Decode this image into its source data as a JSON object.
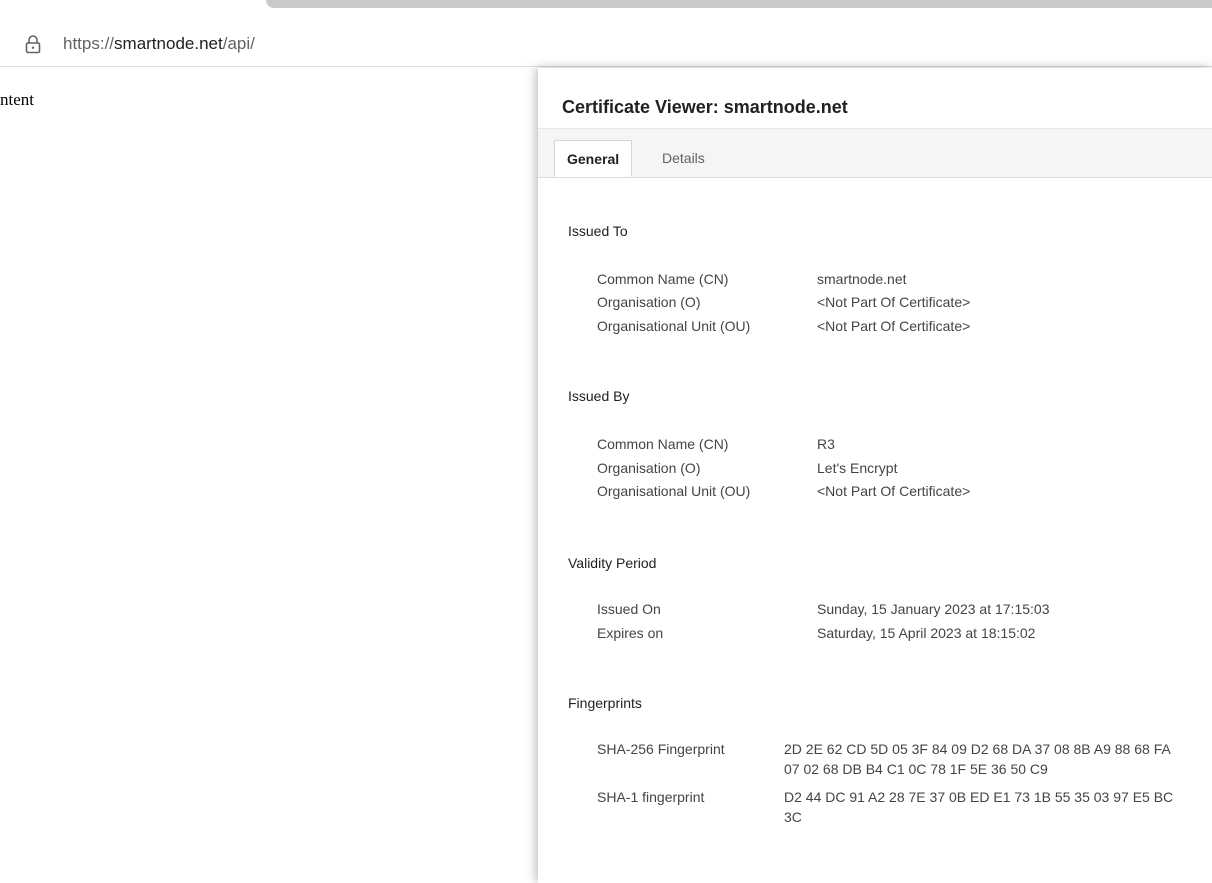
{
  "browser": {
    "url_scheme": "https://",
    "url_host": "smartnode.net",
    "url_path": "/api/"
  },
  "page": {
    "text_fragment": "ntent"
  },
  "dialog": {
    "title": "Certificate Viewer: smartnode.net",
    "tabs": [
      {
        "label": "General",
        "active": true
      },
      {
        "label": "Details",
        "active": false
      }
    ],
    "issued_to": {
      "heading": "Issued To",
      "rows": [
        {
          "label": "Common Name (CN)",
          "value": "smartnode.net"
        },
        {
          "label": "Organisation (O)",
          "value": "<Not Part Of Certificate>"
        },
        {
          "label": "Organisational Unit (OU)",
          "value": "<Not Part Of Certificate>"
        }
      ]
    },
    "issued_by": {
      "heading": "Issued By",
      "rows": [
        {
          "label": "Common Name (CN)",
          "value": "R3"
        },
        {
          "label": "Organisation (O)",
          "value": "Let's Encrypt"
        },
        {
          "label": "Organisational Unit (OU)",
          "value": "<Not Part Of Certificate>"
        }
      ]
    },
    "validity": {
      "heading": "Validity Period",
      "rows": [
        {
          "label": "Issued On",
          "value": "Sunday, 15 January 2023 at 17:15:03"
        },
        {
          "label": "Expires on",
          "value": "Saturday, 15 April 2023 at 18:15:02"
        }
      ]
    },
    "fingerprints": {
      "heading": "Fingerprints",
      "rows": [
        {
          "label": "SHA-256 Fingerprint",
          "value": "2D 2E 62 CD 5D 05 3F 84 09 D2 68 DA 37 08 8B A9 88 68 FA 07 02 68 DB B4 C1 0C 78 1F 5E 36 50 C9"
        },
        {
          "label": "SHA-1 fingerprint",
          "value": "D2 44 DC 91 A2 28 7E 37 0B ED E1 73 1B 55 35 03 97 E5 BC 3C"
        }
      ]
    }
  }
}
